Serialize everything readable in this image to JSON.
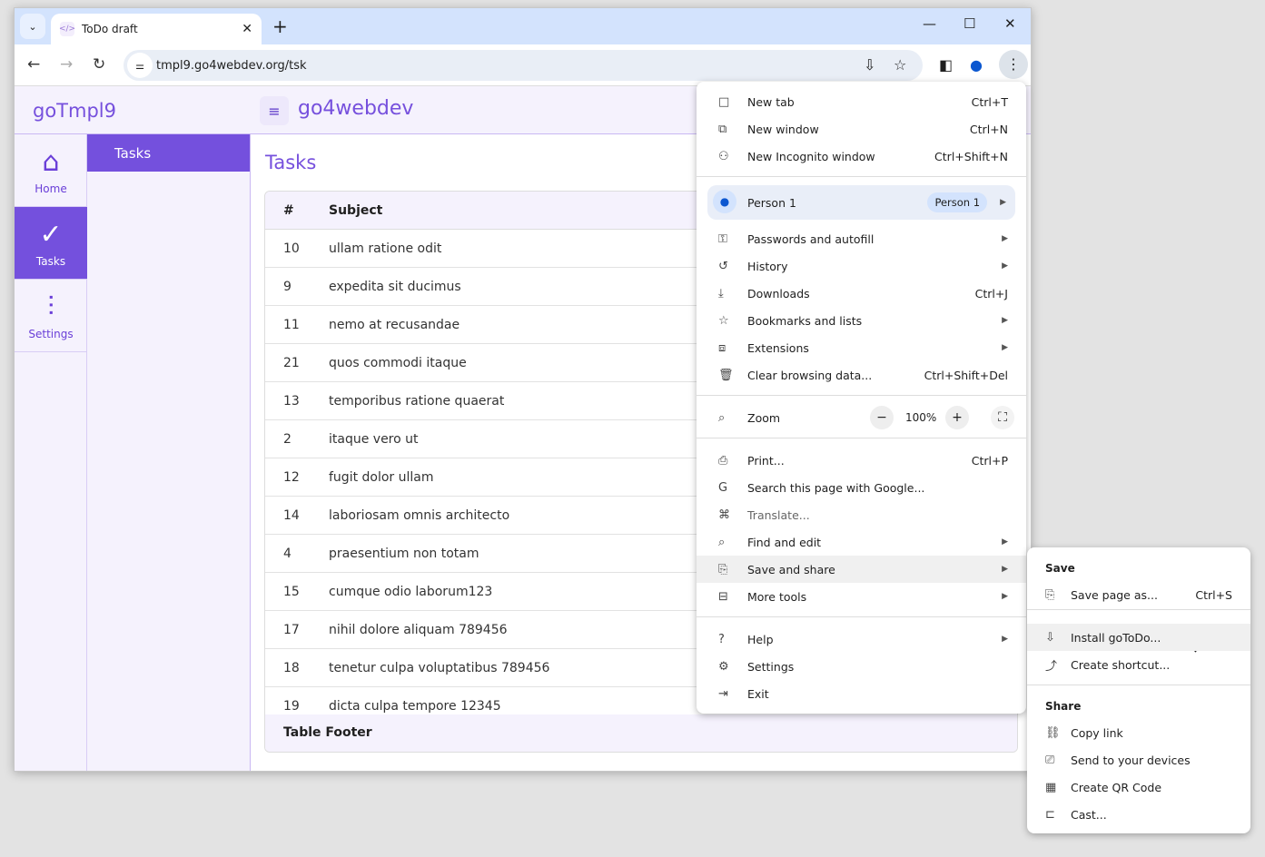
{
  "browser": {
    "tab_title": "ToDo draft",
    "url": "tmpl9.go4webdev.org/tsk"
  },
  "app": {
    "brand": "goTmpl9",
    "title": "go4webdev",
    "page_title": "Tasks",
    "submenu_selected": "Tasks",
    "rail": [
      {
        "label": "Home",
        "icon": "home-icon"
      },
      {
        "label": "Tasks",
        "icon": "check-circle-icon"
      },
      {
        "label": "Settings",
        "icon": "sliders-icon"
      }
    ],
    "accent": "#7450dd"
  },
  "table": {
    "columns": [
      "#",
      "Subject"
    ],
    "rows": [
      [
        "10",
        "ullam ratione odit"
      ],
      [
        "9",
        "expedita sit ducimus"
      ],
      [
        "11",
        "nemo at recusandae"
      ],
      [
        "21",
        "quos commodi itaque"
      ],
      [
        "13",
        "temporibus ratione quaerat"
      ],
      [
        "2",
        "itaque vero ut"
      ],
      [
        "12",
        "fugit dolor ullam"
      ],
      [
        "14",
        "laboriosam omnis architecto"
      ],
      [
        "4",
        "praesentium non totam"
      ],
      [
        "15",
        "cumque odio laborum123"
      ],
      [
        "17",
        "nihil dolore aliquam 789456"
      ],
      [
        "18",
        "tenetur culpa voluptatibus 789456"
      ],
      [
        "19",
        "dicta culpa tempore 12345"
      ]
    ],
    "footer": "Table Footer"
  },
  "menu": {
    "items": [
      {
        "label": "New tab",
        "shortcut": "Ctrl+T",
        "icon": "□"
      },
      {
        "label": "New window",
        "shortcut": "Ctrl+N",
        "icon": "⧉"
      },
      {
        "label": "New Incognito window",
        "shortcut": "Ctrl+Shift+N",
        "icon": "⚇"
      },
      {
        "label": "Passwords and autofill",
        "shortcut": "",
        "icon": "⚿",
        "sub": true
      },
      {
        "label": "History",
        "shortcut": "",
        "icon": "↺",
        "sub": true
      },
      {
        "label": "Downloads",
        "shortcut": "Ctrl+J",
        "icon": "⤓"
      },
      {
        "label": "Bookmarks and lists",
        "shortcut": "",
        "icon": "☆",
        "sub": true
      },
      {
        "label": "Extensions",
        "shortcut": "",
        "icon": "⧈",
        "sub": true
      },
      {
        "label": "Clear browsing data...",
        "shortcut": "Ctrl+Shift+Del",
        "icon": "🗑"
      },
      {
        "label": "Print...",
        "shortcut": "Ctrl+P",
        "icon": "⎙"
      },
      {
        "label": "Search this page with Google...",
        "shortcut": "",
        "icon": "G"
      },
      {
        "label": "Translate...",
        "shortcut": "",
        "icon": "⌘",
        "disabled": true
      },
      {
        "label": "Find and edit",
        "shortcut": "",
        "icon": "⌕",
        "sub": true
      },
      {
        "label": "Save and share",
        "shortcut": "",
        "icon": "⎘",
        "sub": true
      },
      {
        "label": "More tools",
        "shortcut": "",
        "icon": "⊟",
        "sub": true
      },
      {
        "label": "Help",
        "shortcut": "",
        "icon": "?",
        "sub": true
      },
      {
        "label": "Settings",
        "shortcut": "",
        "icon": "⚙"
      },
      {
        "label": "Exit",
        "shortcut": "",
        "icon": "⇥"
      }
    ],
    "person": {
      "label": "Person 1",
      "chip": "Person 1"
    },
    "zoom": {
      "label": "Zoom",
      "value": "100%"
    }
  },
  "submenu": {
    "save_header": "Save",
    "share_header": "Share",
    "items": [
      {
        "label": "Save page as...",
        "shortcut": "Ctrl+S"
      },
      {
        "label": "Install goToDo...",
        "shortcut": ""
      },
      {
        "label": "Create shortcut...",
        "shortcut": ""
      },
      {
        "label": "Copy link",
        "shortcut": ""
      },
      {
        "label": "Send to your devices",
        "shortcut": ""
      },
      {
        "label": "Create QR Code",
        "shortcut": ""
      },
      {
        "label": "Cast...",
        "shortcut": ""
      }
    ]
  }
}
